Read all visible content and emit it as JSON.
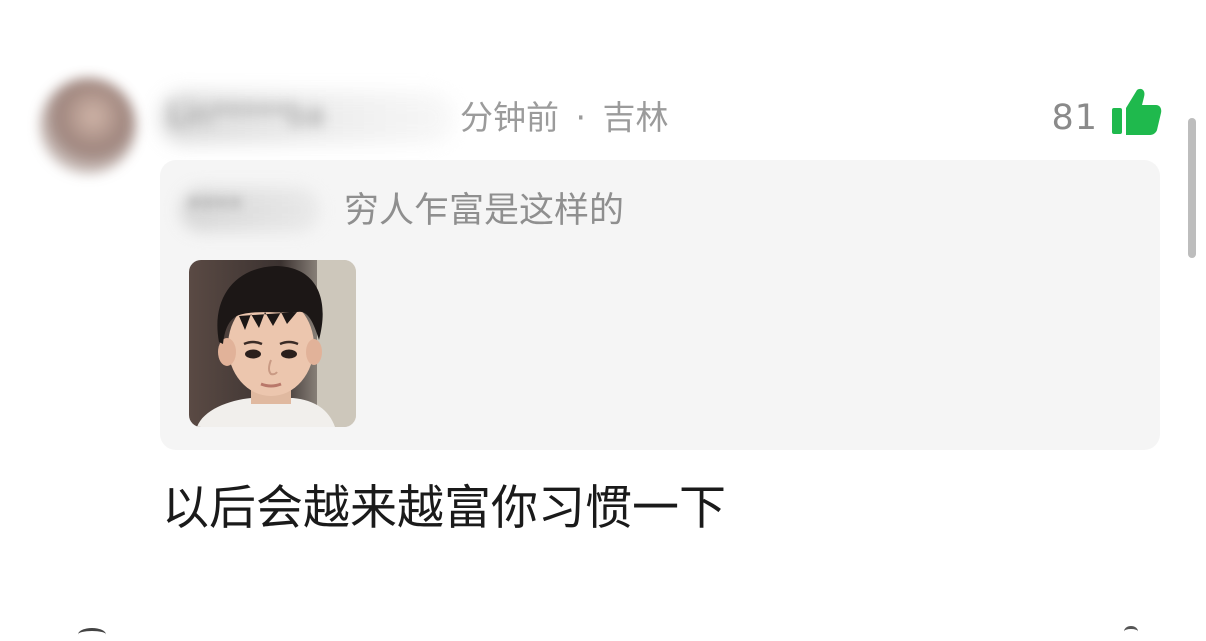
{
  "comment": {
    "username": "Lin*****ba",
    "time": "分钟前",
    "separator": "·",
    "location": "吉林",
    "like_count": "81",
    "like_icon": "thumbs-up-icon",
    "accent_color": "#1fb94d",
    "text": "以后会越来越富你习惯一下"
  },
  "quote": {
    "username": "****",
    "text": "穷人乍富是这样的",
    "image": "boy-portrait-photo"
  }
}
